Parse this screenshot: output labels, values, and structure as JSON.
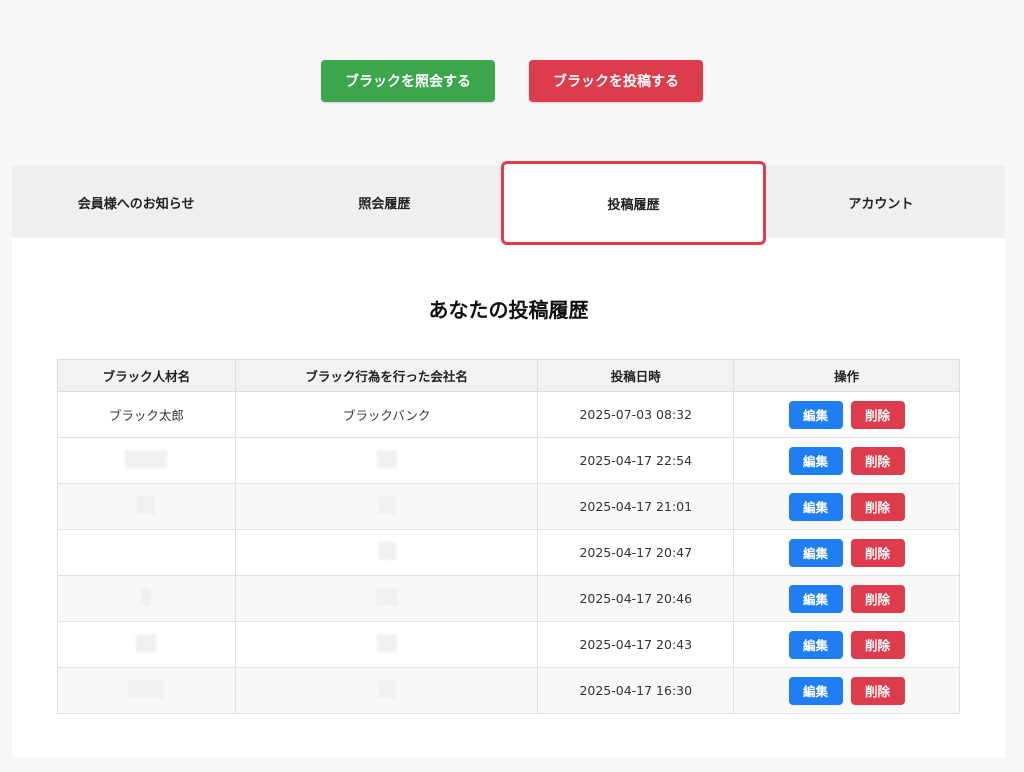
{
  "top_actions": {
    "inquire_label": "ブラックを照会する",
    "post_label": "ブラックを投稿する"
  },
  "tabs": [
    {
      "label": "会員様へのお知らせ"
    },
    {
      "label": "照会履歴"
    },
    {
      "label": "投稿履歴",
      "active": true
    },
    {
      "label": "アカウント"
    }
  ],
  "page_title": "あなたの投稿履歴",
  "table": {
    "headers": [
      "ブラック人材名",
      "ブラック行為を行った会社名",
      "投稿日時",
      "操作"
    ],
    "edit_label": "編集",
    "delete_label": "削除",
    "rows": [
      {
        "name": "ブラック太郎",
        "company": "ブラックバンク",
        "date": "2025-07-03 08:32"
      },
      {
        "name": "",
        "company": "",
        "date": "2025-04-17 22:54"
      },
      {
        "name": "",
        "company": "",
        "date": "2025-04-17 21:01"
      },
      {
        "name": "",
        "company": "",
        "date": "2025-04-17 20:47"
      },
      {
        "name": "",
        "company": "",
        "date": "2025-04-17 20:46"
      },
      {
        "name": "",
        "company": "",
        "date": "2025-04-17 20:43"
      },
      {
        "name": "",
        "company": "",
        "date": "2025-04-17 16:30"
      }
    ]
  },
  "colors": {
    "green": "#3ba64b",
    "red": "#dc3c4b",
    "blue": "#1e7ef2",
    "active_tab_border": "#e23b4a"
  }
}
